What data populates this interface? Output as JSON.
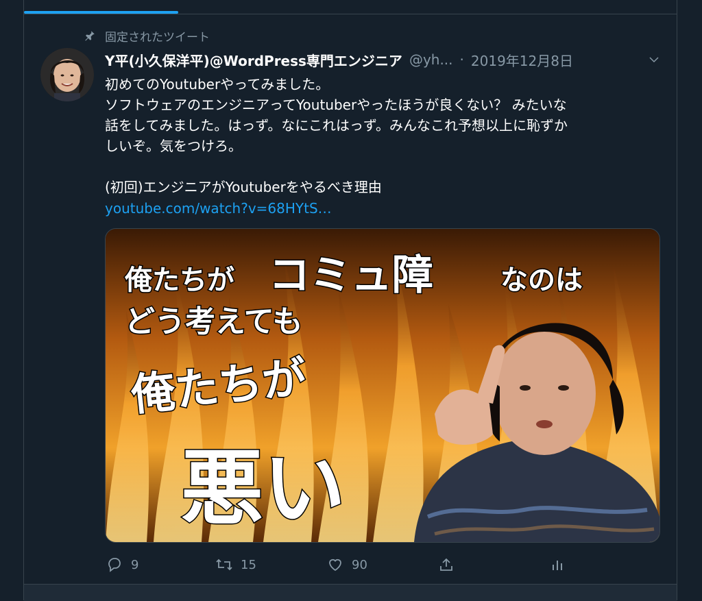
{
  "pinned": {
    "label": "固定されたツイート"
  },
  "tweet": {
    "display_name": "Y平(小久保洋平)@WordPress専門エンジニア",
    "handle": "@yh...",
    "separator": "·",
    "date": "2019年12月8日",
    "text": "初めてのYoutuberやってみました。\nソフトウェアのエンジニアってYoutuberやったほうが良くない？ みたいな\n話をしてみました。はっず。なにこれはっず。みんなこれ予想以上に恥ずか\nしいぞ。気をつけろ。\n\n(初回)エンジニアがYoutuberをやるべき理由",
    "link": "youtube.com/watch?v=68HYtS…"
  },
  "media": {
    "line1_a": "俺たちが",
    "line1_b": "コミュ障",
    "line1_c": "なのは",
    "line2": "どう考えても",
    "line3": "俺たちが",
    "line4": "悪い"
  },
  "actions": {
    "reply_count": "9",
    "retweet_count": "15",
    "like_count": "90"
  },
  "icons": {
    "pin": "pin-icon",
    "chevron": "chevron-down-icon",
    "reply": "reply-icon",
    "retweet": "retweet-icon",
    "like": "heart-icon",
    "share": "share-icon",
    "analytics": "analytics-icon"
  },
  "colors": {
    "background": "#15202b",
    "accent": "#1da1f2",
    "secondary_text": "#8899a6"
  }
}
